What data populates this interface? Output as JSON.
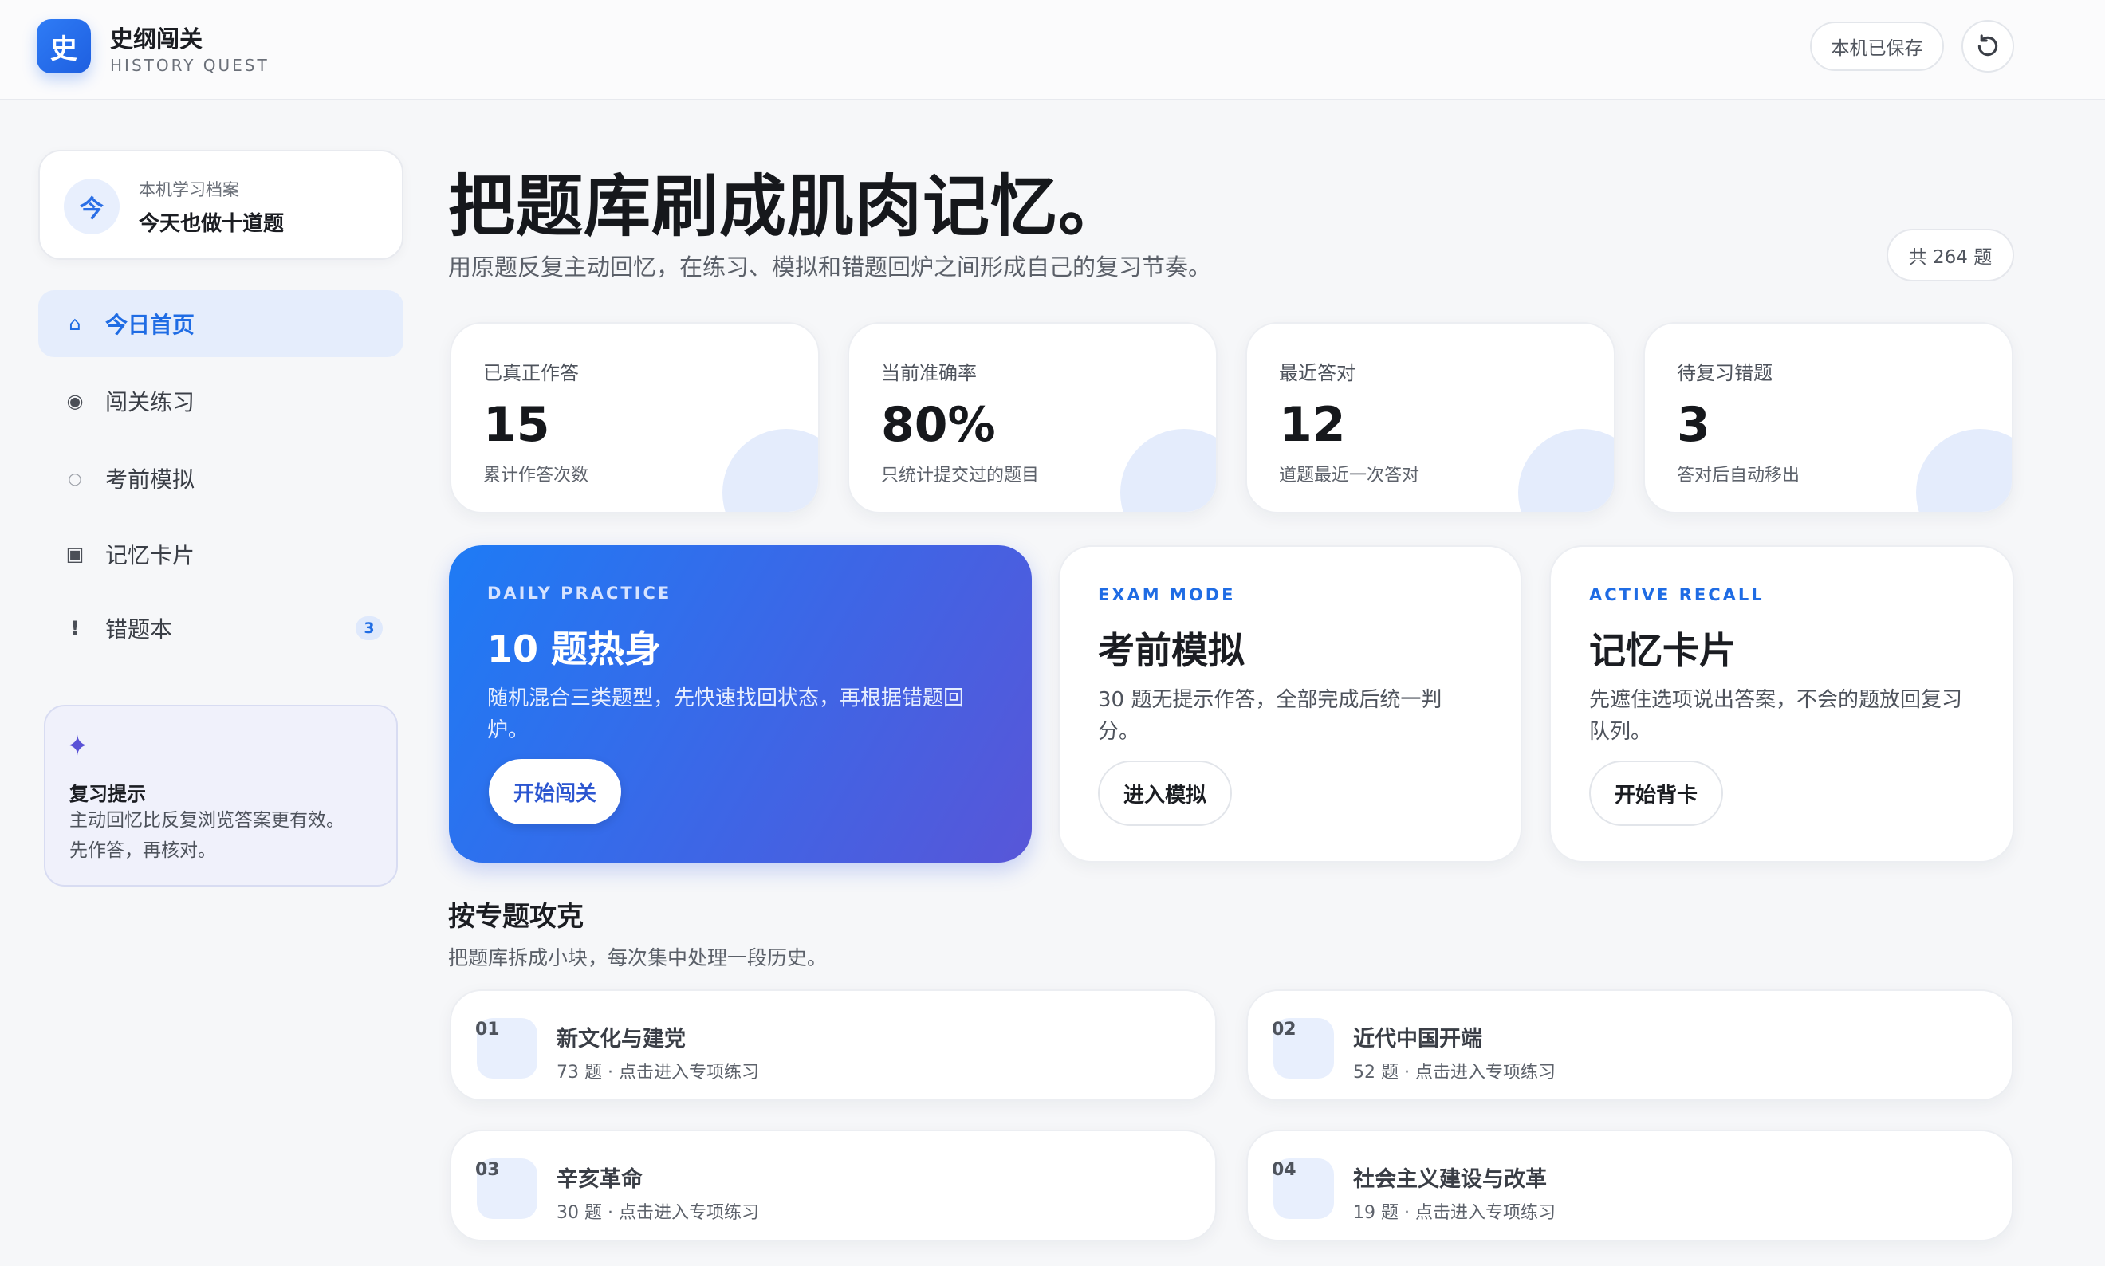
{
  "app": {
    "logo_char": "史",
    "title": "史纲闯关",
    "subtitle": "HISTORY QUEST",
    "saved_label": "本机已保存",
    "refresh_icon": "refresh-icon"
  },
  "sidebar": {
    "profile": {
      "avatar_char": "今",
      "label": "本机学习档案",
      "title": "今天也做十道题"
    },
    "items": [
      {
        "icon": "⌂",
        "icon_name": "home-icon",
        "label": "今日首页",
        "active": true
      },
      {
        "icon": "◉",
        "icon_name": "target-icon",
        "label": "闯关练习"
      },
      {
        "icon": "○",
        "icon_name": "circle-icon",
        "label": "考前模拟"
      },
      {
        "icon": "▣",
        "icon_name": "card-icon",
        "label": "记忆卡片"
      },
      {
        "icon": "!",
        "icon_name": "alert-icon",
        "label": "错题本",
        "badge": "3"
      }
    ],
    "tip": {
      "icon": "✦",
      "title": "复习提示",
      "text_line1": "主动回忆比反复浏览答案更有效。",
      "text_line2": "先作答，再核对。"
    }
  },
  "main": {
    "title": "把题库刷成肌肉记忆。",
    "subtitle": "用原题反复主动回忆，在练习、模拟和错题回炉之间形成自己的复习节奏。",
    "total": "共 264 题",
    "stats": [
      {
        "label": "已真正作答",
        "value": "15",
        "note": "累计作答次数"
      },
      {
        "label": "当前准确率",
        "value": "80%",
        "note": "只统计提交过的题目"
      },
      {
        "label": "最近答对",
        "value": "12",
        "note": "道题最近一次答对"
      },
      {
        "label": "待复习错题",
        "value": "3",
        "note": "答对后自动移出"
      }
    ],
    "modes": [
      {
        "kicker": "DAILY PRACTICE",
        "title": "10 题热身",
        "desc_line1": "随机混合三类题型，先快速找回状态，再根据错题回",
        "desc_line2": "炉。",
        "button": "开始闯关"
      },
      {
        "kicker": "EXAM MODE",
        "title": "考前模拟",
        "desc_line1": "30 题无提示作答，全部完成后统一判",
        "desc_line2": "分。",
        "button": "进入模拟"
      },
      {
        "kicker": "ACTIVE RECALL",
        "title": "记忆卡片",
        "desc_line1": "先遮住选项说出答案，不会的题放回复习",
        "desc_line2": "队列。",
        "button": "开始背卡"
      }
    ],
    "section": {
      "title": "按专题攻克",
      "subtitle": "把题库拆成小块，每次集中处理一段历史。"
    },
    "topics": [
      {
        "num": "01",
        "name": "新文化与建党",
        "meta": "73 题 · 点击进入专项练习"
      },
      {
        "num": "02",
        "name": "近代中国开端",
        "meta": "52 题 · 点击进入专项练习"
      },
      {
        "num": "03",
        "name": "辛亥革命",
        "meta": "30 题 · 点击进入专项练习"
      },
      {
        "num": "04",
        "name": "社会主义建设与改革",
        "meta": "19 题 · 点击进入专项练习"
      }
    ]
  }
}
